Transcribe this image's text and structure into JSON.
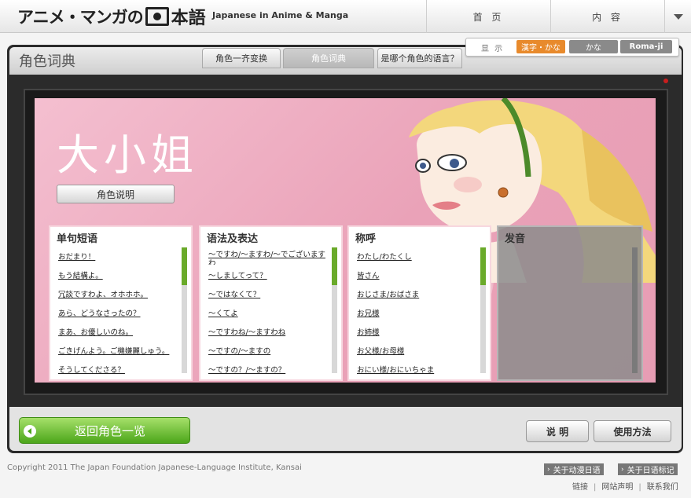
{
  "header": {
    "logo_kana": "アニメ・マンガの",
    "logo_kanji": "本語",
    "logo_sub": "Japanese in Anime & Manga",
    "nav_home": "首 页",
    "nav_contents": "内 容"
  },
  "page": {
    "title": "角色词典",
    "tabs": [
      "角色一齐变换",
      "角色词典",
      "是哪个角色的语言？"
    ]
  },
  "display": {
    "label": "显 示",
    "modes": [
      "漢字・かな",
      "かな",
      "Roma-ji"
    ],
    "selected": "漢字・かな",
    "selected_color": "#e88a2c"
  },
  "character": {
    "name": "大小姐",
    "desc_button": "角色说明"
  },
  "panels": [
    {
      "title": "单句短语",
      "items": [
        "おだまり！",
        "もう結構よ。",
        "冗談ですわよ、オホホホ。",
        "あら、どうなさったの？",
        "まあ、お優しいのね。",
        "ごきげんよう。ご機嫌麗しゅう。",
        "そうしてくださる？"
      ]
    },
    {
      "title": "语法及表达",
      "items": [
        "～ですわ/～ますわ/～でございますわ",
        "～しましてって？",
        "～ではなくて？",
        "～くてよ",
        "～ですわね/～ますわね",
        "～ですの/～ますの",
        "～ですの？/～ますの？"
      ]
    },
    {
      "title": "称呼",
      "items": [
        "わたし/わたくし",
        "皆さん",
        "おじさま/おばさま",
        "お兄様",
        "お姉様",
        "お父様/お母様",
        "おにい様/おにいちゃま"
      ]
    },
    {
      "title": "发音",
      "items": []
    }
  ],
  "bottom": {
    "back_button": "返回角色一览",
    "explain_button": "说 明",
    "usage_button": "使用方法"
  },
  "footer": {
    "copyright": "Copyright 2011 The Japan Foundation Japanese-Language Institute, Kansai",
    "tag_about": "关于动漫日语",
    "tag_notation": "关于日语标记",
    "links": [
      "链接",
      "网站声明",
      "联系我们"
    ]
  },
  "colors": {
    "accent_green": "#4ca61a",
    "screen_pink": "#eaa2b8",
    "scroll_green": "#6aaa2a"
  }
}
